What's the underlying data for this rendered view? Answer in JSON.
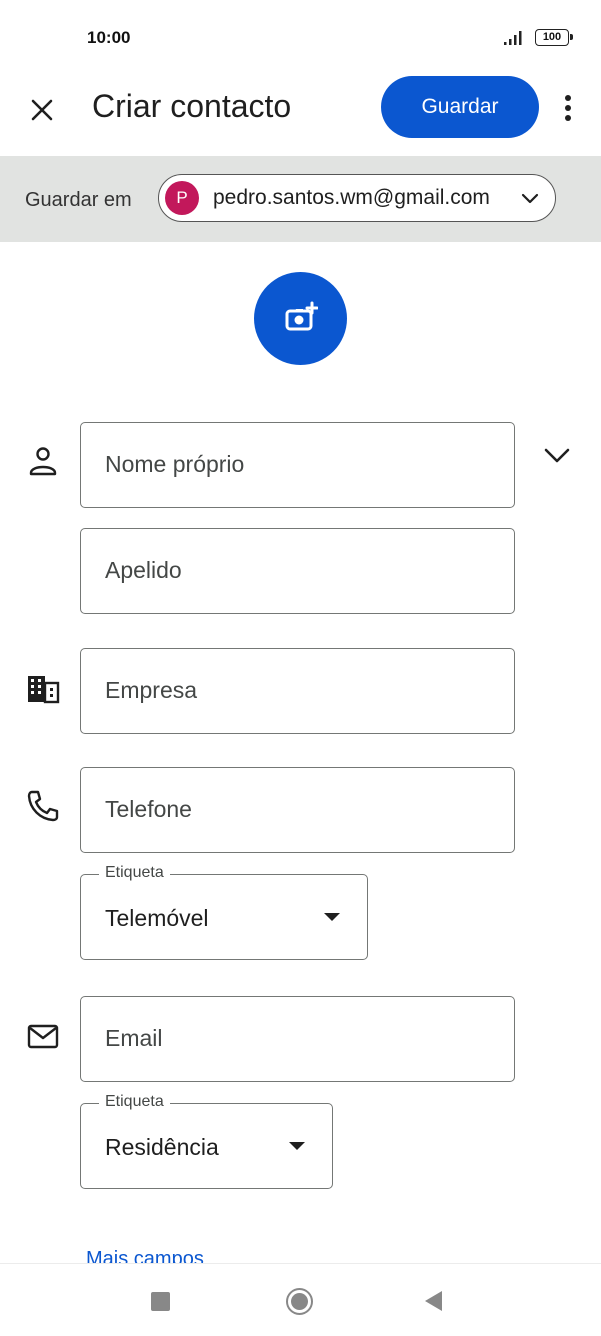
{
  "status_bar": {
    "time": "10:00",
    "battery": "100"
  },
  "app_bar": {
    "title": "Criar contacto",
    "save_label": "Guardar"
  },
  "save_to": {
    "label": "Guardar em",
    "avatar_letter": "P",
    "email": "pedro.santos.wm@gmail.com"
  },
  "form": {
    "first_name_placeholder": "Nome próprio",
    "last_name_placeholder": "Apelido",
    "company_placeholder": "Empresa",
    "phone_placeholder": "Telefone",
    "phone_label_title": "Etiqueta",
    "phone_label_value": "Telemóvel",
    "email_placeholder": "Email",
    "email_label_title": "Etiqueta",
    "email_label_value": "Residência",
    "more_fields": "Mais campos"
  },
  "colors": {
    "accent": "#0b57d0",
    "save_to_bg": "#e1e3e1",
    "avatar": "#c2185b"
  },
  "icons": [
    "close-icon",
    "more-vert-icon",
    "chevron-down-icon",
    "add-photo-icon",
    "person-icon",
    "business-icon",
    "phone-icon",
    "mail-icon"
  ]
}
